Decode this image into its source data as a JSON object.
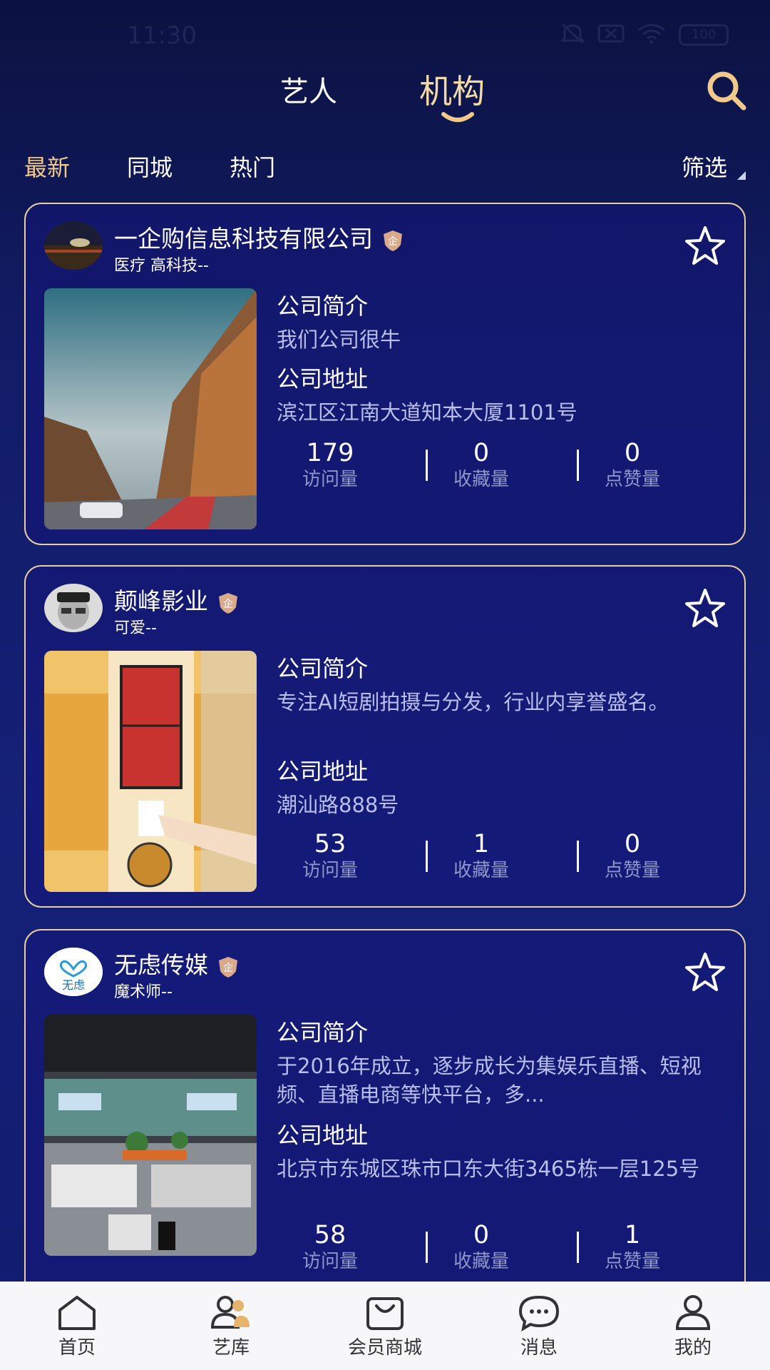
{
  "status_bar": {
    "time": "11:30",
    "battery": "100"
  },
  "top_tabs": {
    "artist": "艺人",
    "org": "机构"
  },
  "filters": {
    "latest": "最新",
    "same_city": "同城",
    "hot": "热门",
    "filter": "筛选"
  },
  "labels": {
    "intro": "公司简介",
    "address": "公司地址",
    "visits": "访问量",
    "favorites": "收藏量",
    "likes": "点赞量"
  },
  "cards": [
    {
      "name": "一企购信息科技有限公司",
      "tags": "医疗 高科技--",
      "intro": "我们公司很牛",
      "address": "滨江区江南大道知本大厦1101号",
      "visits": "179",
      "favorites": "0",
      "likes": "0"
    },
    {
      "name": "颠峰影业",
      "tags": "可爱--",
      "intro": "专注AI短剧拍摄与分发，行业内享誉盛名。",
      "address": "潮汕路888号",
      "visits": "53",
      "favorites": "1",
      "likes": "0"
    },
    {
      "name": "无虑传媒",
      "tags": "魔术师--",
      "logo_text": "无虑",
      "intro": "于2016年成立，逐步成长为集娱乐直播、短视频、直播电商等快平台，多...",
      "address": "北京市东城区珠市口东大街3465栋一层125号",
      "visits": "58",
      "favorites": "0",
      "likes": "1"
    }
  ],
  "nav": {
    "home": "首页",
    "library": "艺库",
    "mall": "会员商城",
    "messages": "消息",
    "mine": "我的"
  },
  "colors": {
    "accent": "#f2c98c",
    "card_border": "#e8cfa0",
    "background": "#121c66"
  }
}
